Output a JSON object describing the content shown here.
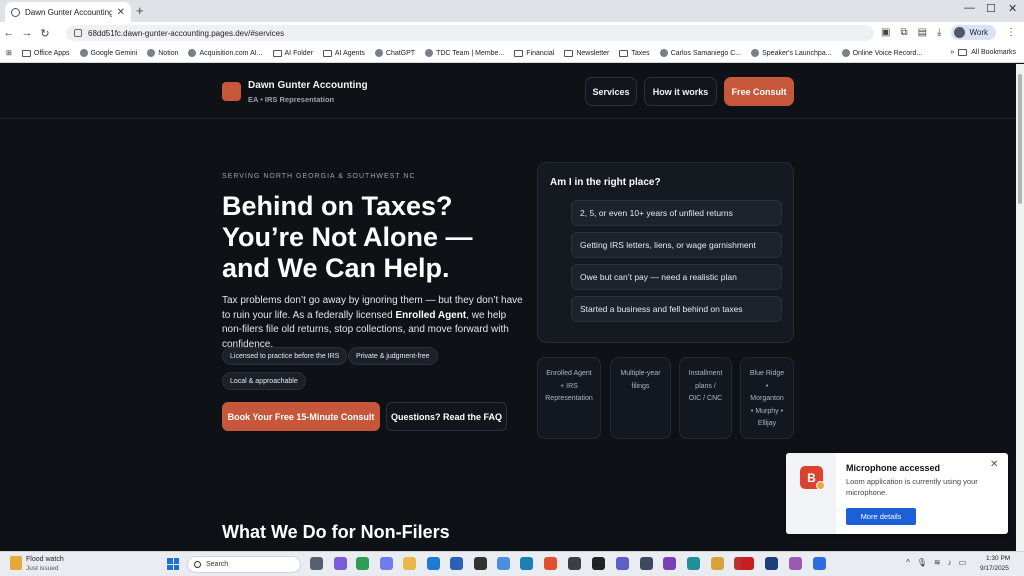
{
  "browser": {
    "tab_title": "Dawn Gunter Accounting | He",
    "url": "68dd51fc.dawn-gunter-accounting.pages.dev/#services",
    "profile_label": "Work",
    "bookmarks": [
      "Office Apps",
      "Google Gemini",
      "Notion",
      "Acquisition.com AI...",
      "AI Folder",
      "AI Agents",
      "ChatGPT",
      "TDC Team | Membe...",
      "Financial",
      "Newsletter",
      "Taxes",
      "Carlos Samaniego C...",
      "Speaker's Launchpa...",
      "Online Voice Record..."
    ],
    "all_bookmarks": "All Bookmarks"
  },
  "site": {
    "brand_name": "Dawn Gunter Accounting",
    "brand_tagline": "EA • IRS Representation",
    "nav": {
      "services": "Services",
      "how_it_works": "How it works",
      "free_consult": "Free Consult"
    },
    "hero": {
      "eyebrow": "SERVING NORTH GEORGIA & SOUTHWEST NC",
      "title_line1": "Behind on Taxes?",
      "title_line2": "You’re Not Alone —",
      "title_line3": "and We Can Help.",
      "sub_part1": "Tax problems don’t go away by ignoring them — but they don’t have to ruin your life. As a federally licensed ",
      "sub_bold": "Enrolled Agent",
      "sub_part2": ", we help non-filers file old returns, stop collections, and move forward with confidence.",
      "chips": [
        "Licensed to practice before the IRS",
        "Private & judgment-free",
        "Local & approachable"
      ],
      "cta_primary": "Book Your Free 15-Minute Consult",
      "cta_secondary": "Questions? Read the FAQ"
    },
    "quiz": {
      "title": "Am I in the right place?",
      "options": [
        "2, 5, or even 10+ years of unfiled returns",
        "Getting IRS letters, liens, or wage garnishment",
        "Owe but can’t pay — need a realistic plan",
        "Started a business and fell behind on taxes"
      ]
    },
    "stats": [
      [
        "Enrolled Agent",
        "+ IRS",
        "Representation"
      ],
      [
        "Multiple-year",
        "filings"
      ],
      [
        "Installment",
        "plans /",
        "OIC / CNC"
      ],
      [
        "Blue Ridge",
        "•",
        "Morganton",
        "• Murphy •",
        "Ellijay"
      ]
    ],
    "section_title": "What We Do for Non-Filers"
  },
  "notification": {
    "app_letter": "B",
    "title": "Microphone accessed",
    "body": "Loom application is currently using your microphone.",
    "button": "More details"
  },
  "taskbar": {
    "weather_title": "Flood watch",
    "weather_sub": "Just issued",
    "search_placeholder": "Search",
    "time": "1:30 PM",
    "date": "9/17/2025"
  }
}
